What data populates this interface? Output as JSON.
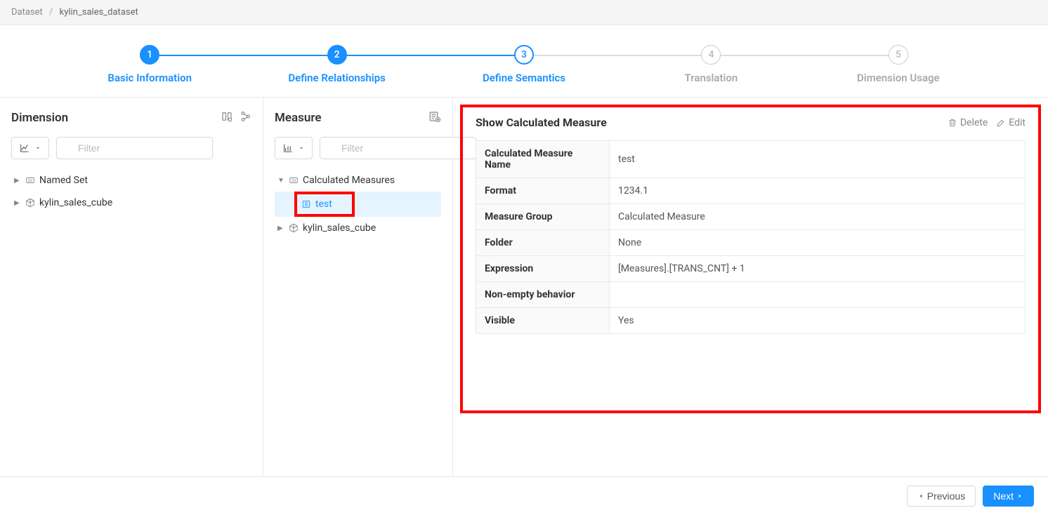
{
  "breadcrumb": {
    "root": "Dataset",
    "current": "kylin_sales_dataset"
  },
  "stepper": {
    "steps": [
      {
        "num": "1",
        "label": "Basic Information"
      },
      {
        "num": "2",
        "label": "Define Relationships"
      },
      {
        "num": "3",
        "label": "Define Semantics"
      },
      {
        "num": "4",
        "label": "Translation"
      },
      {
        "num": "5",
        "label": "Dimension Usage"
      }
    ]
  },
  "dimension_panel": {
    "title": "Dimension",
    "filter_placeholder": "Filter",
    "tree": {
      "named_set": "Named Set",
      "cube": "kylin_sales_cube"
    }
  },
  "measure_panel": {
    "title": "Measure",
    "filter_placeholder": "Filter",
    "tree": {
      "calc_measures": "Calculated Measures",
      "test_item": "test",
      "cube": "kylin_sales_cube"
    }
  },
  "detail": {
    "title": "Show Calculated Measure",
    "delete_label": "Delete",
    "edit_label": "Edit",
    "rows": {
      "name_label": "Calculated Measure Name",
      "name_value": "test",
      "format_label": "Format",
      "format_value": "1234.1",
      "group_label": "Measure Group",
      "group_value": "Calculated Measure",
      "folder_label": "Folder",
      "folder_value": "None",
      "expr_label": "Expression",
      "expr_value": "[Measures].[TRANS_CNT] + 1",
      "nonempty_label": "Non-empty behavior",
      "nonempty_value": "",
      "visible_label": "Visible",
      "visible_value": "Yes"
    }
  },
  "footer": {
    "previous": "Previous",
    "next": "Next"
  }
}
